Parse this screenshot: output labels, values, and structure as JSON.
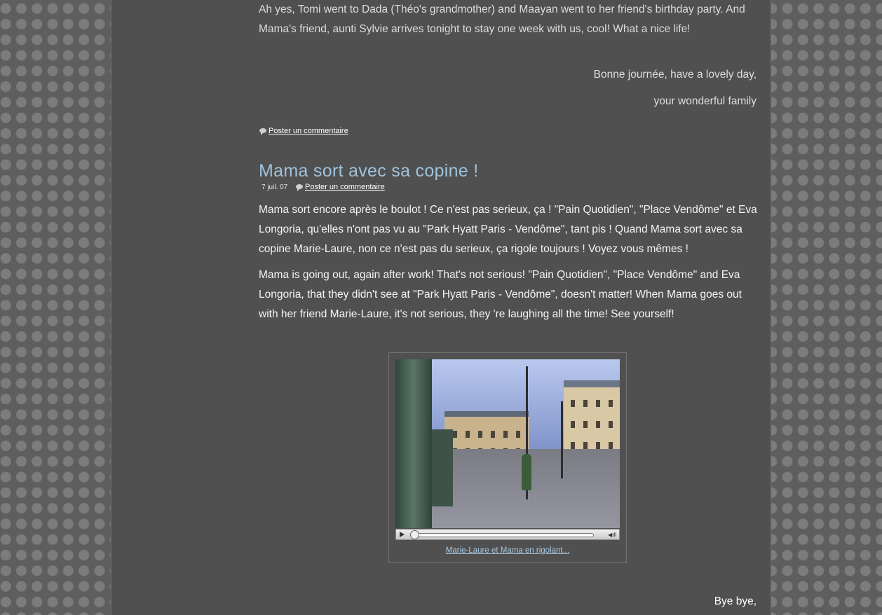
{
  "intro": {
    "text": "Ah yes, Tomi went to Dada (Théo's grandmother) and Maayan went to her friend's birthday party. And Mama's friend, aunti Sylvie arrives tonight to stay one week with us, cool! What a nice life!",
    "sign_1": "Bonne journée, have a lovely day,",
    "sign_2": "your wonderful family",
    "comment_link": "Poster un commentaire"
  },
  "post": {
    "title": "Mama sort avec sa copine !",
    "date": "7 juil. 07",
    "comment_link": "Poster un commentaire",
    "paragraph_fr": "Mama sort encore après le boulot ! Ce n'est pas serieux, ça ! \"Pain Quotidien\", \"Place Vendôme\" et Eva Longoria, qu'elles n'ont pas vu au \"Park Hyatt Paris - Vendôme\", tant pis ! Quand Mama sort avec sa copine Marie-Laure, non ce n'est pas du serieux, ça rigole toujours ! Voyez vous mêmes !",
    "paragraph_en": "Mama is going out, again after work! That's not serious! \"Pain Quotidien\", \"Place Vendôme\" and Eva Longoria, that they didn't see at \"Park Hyatt Paris - Vendôme\", doesn't matter! When Mama goes out with her friend Marie-Laure, it's not serious, they 're laughing all the time! See yourself!",
    "video": {
      "caption": "Marie-Laure et Mama en rigolant...",
      "progress": 0
    },
    "closing": "Bye bye,"
  },
  "colors": {
    "title": "#9ec3dc",
    "caption": "#a8c8e0",
    "page_bg": "#505050"
  }
}
